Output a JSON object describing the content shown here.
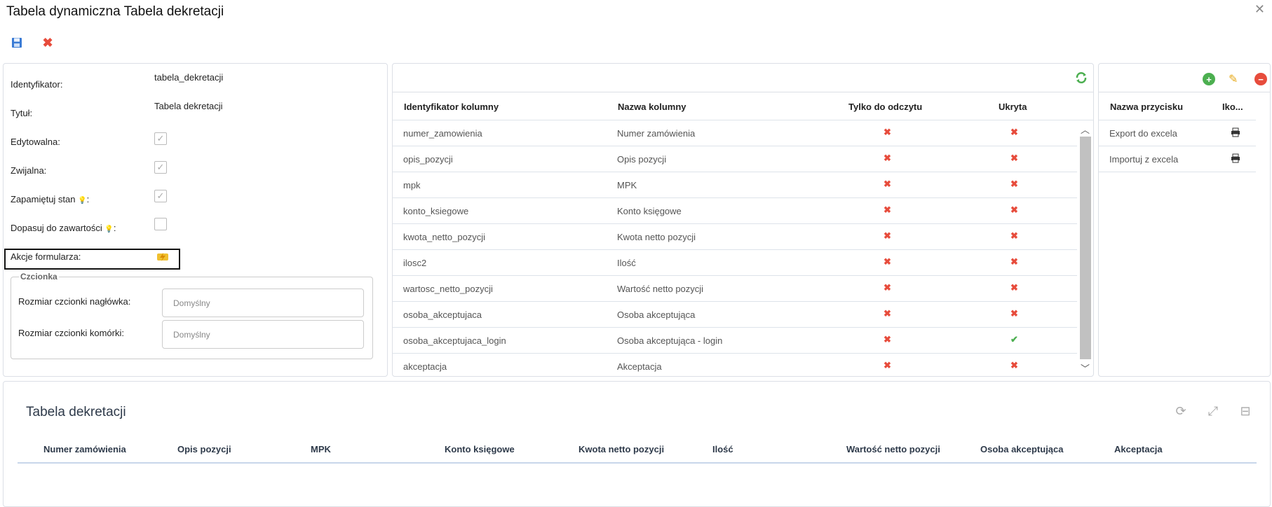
{
  "window": {
    "title": "Tabela dynamiczna Tabela dekretacji"
  },
  "toolbar": {
    "save_icon": "save-icon",
    "cancel_icon": "cancel-icon"
  },
  "form": {
    "identyfikator_label": "Identyfikator:",
    "identyfikator_value": "tabela_dekretacji",
    "tytul_label": "Tytuł:",
    "tytul_value": "Tabela dekretacji",
    "edytowalna_label": "Edytowalna:",
    "edytowalna_checked": true,
    "zwijalna_label": "Zwijalna:",
    "zwijalna_checked": true,
    "zapamietuj_label": "Zapamiętuj stan",
    "zapamietuj_checked": true,
    "dopasuj_label": "Dopasuj do zawartości",
    "dopasuj_checked": false,
    "colon": ":",
    "akcje_label": "Akcje formularza:",
    "czcionka_legend": "Czcionka",
    "naglowek_label": "Rozmiar czcionki nagłówka:",
    "naglowek_placeholder": "Domyślny",
    "komorka_label": "Rozmiar czcionki komórki:",
    "komorka_placeholder": "Domyślny"
  },
  "columns_table": {
    "headers": [
      "Identyfikator kolumny",
      "Nazwa kolumny",
      "Tylko do odczytu",
      "Ukryta"
    ],
    "rows": [
      {
        "id": "numer_zamowienia",
        "name": "Numer zamówienia",
        "readonly": false,
        "hidden": false
      },
      {
        "id": "opis_pozycji",
        "name": "Opis pozycji",
        "readonly": false,
        "hidden": false
      },
      {
        "id": "mpk",
        "name": "MPK",
        "readonly": false,
        "hidden": false
      },
      {
        "id": "konto_ksiegowe",
        "name": "Konto księgowe",
        "readonly": false,
        "hidden": false
      },
      {
        "id": "kwota_netto_pozycji",
        "name": "Kwota netto pozycji",
        "readonly": false,
        "hidden": false
      },
      {
        "id": "ilosc2",
        "name": "Ilość",
        "readonly": false,
        "hidden": false
      },
      {
        "id": "wartosc_netto_pozycji",
        "name": "Wartość netto pozycji",
        "readonly": false,
        "hidden": false
      },
      {
        "id": "osoba_akceptujaca",
        "name": "Osoba akceptująca",
        "readonly": false,
        "hidden": false
      },
      {
        "id": "osoba_akceptujaca_login",
        "name": "Osoba akceptująca - login",
        "readonly": false,
        "hidden": true
      },
      {
        "id": "akceptacja",
        "name": "Akceptacja",
        "readonly": false,
        "hidden": false
      }
    ]
  },
  "buttons_table": {
    "headers": [
      "Nazwa przycisku",
      "Iko..."
    ],
    "rows": [
      {
        "name": "Export do excela",
        "icon": "printer-icon"
      },
      {
        "name": "Importuj z excela",
        "icon": "printer-icon"
      }
    ]
  },
  "preview": {
    "title": "Tabela dekretacji",
    "headers": [
      "Numer zamówienia",
      "Opis pozycji",
      "MPK",
      "Konto księgowe",
      "Kwota netto pozycji",
      "Ilość",
      "Wartość netto pozycji",
      "Osoba akceptująca",
      "Akceptacja"
    ]
  },
  "colors": {
    "red_x": "#e74c3c",
    "green_check": "#4caf50",
    "accent": "#2e3a4a"
  }
}
